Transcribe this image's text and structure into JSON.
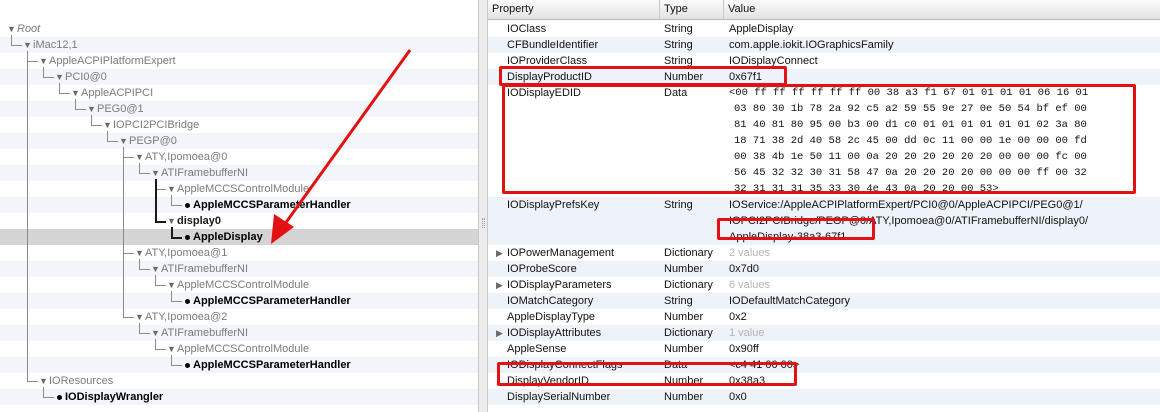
{
  "tree": {
    "nodes": [
      {
        "id": "root",
        "label": "Root",
        "level": 0,
        "triangle": "open",
        "style": "root"
      },
      {
        "id": "imac",
        "label": "iMac12,1",
        "level": 1,
        "triangle": "open",
        "style": "normal"
      },
      {
        "id": "acpi-platform",
        "label": "AppleACPIPlatformExpert",
        "level": 2,
        "triangle": "open",
        "style": "normal"
      },
      {
        "id": "pci0",
        "label": "PCI0@0",
        "level": 3,
        "triangle": "open",
        "style": "normal"
      },
      {
        "id": "acpi-pci",
        "label": "AppleACPIPCI",
        "level": 4,
        "triangle": "open",
        "style": "normal"
      },
      {
        "id": "peg0",
        "label": "PEG0@1",
        "level": 5,
        "triangle": "open",
        "style": "normal"
      },
      {
        "id": "pci2pci",
        "label": "IOPCI2PCIBridge",
        "level": 6,
        "triangle": "open",
        "style": "normal"
      },
      {
        "id": "pegp",
        "label": "PEGP@0",
        "level": 7,
        "triangle": "open",
        "style": "normal"
      },
      {
        "id": "aty0",
        "label": "ATY,Ipomoea@0",
        "level": 8,
        "triangle": "open",
        "style": "normal"
      },
      {
        "id": "fb0",
        "label": "ATIFramebufferNI",
        "level": 9,
        "triangle": "open",
        "style": "normal"
      },
      {
        "id": "mccs0",
        "label": "AppleMCCSControlModule",
        "level": 10,
        "triangle": "open",
        "style": "normal"
      },
      {
        "id": "handler0",
        "label": "AppleMCCSParameterHandler",
        "level": 11,
        "triangle": "none",
        "style": "leaf"
      },
      {
        "id": "display0",
        "label": "display0",
        "level": 10,
        "triangle": "open",
        "style": "dark"
      },
      {
        "id": "appledisplay",
        "label": "AppleDisplay",
        "level": 11,
        "triangle": "none",
        "style": "leaf",
        "selected": true
      },
      {
        "id": "aty1",
        "label": "ATY,Ipomoea@1",
        "level": 8,
        "triangle": "open",
        "style": "normal"
      },
      {
        "id": "fb1",
        "label": "ATIFramebufferNI",
        "level": 9,
        "triangle": "open",
        "style": "normal"
      },
      {
        "id": "mccs1",
        "label": "AppleMCCSControlModule",
        "level": 10,
        "triangle": "open",
        "style": "normal"
      },
      {
        "id": "handler1",
        "label": "AppleMCCSParameterHandler",
        "level": 11,
        "triangle": "none",
        "style": "leaf"
      },
      {
        "id": "aty2",
        "label": "ATY,Ipomoea@2",
        "level": 8,
        "triangle": "open",
        "style": "normal"
      },
      {
        "id": "fb2",
        "label": "ATIFramebufferNI",
        "level": 9,
        "triangle": "open",
        "style": "normal"
      },
      {
        "id": "mccs2",
        "label": "AppleMCCSControlModule",
        "level": 10,
        "triangle": "open",
        "style": "normal"
      },
      {
        "id": "handler2",
        "label": "AppleMCCSParameterHandler",
        "level": 11,
        "triangle": "none",
        "style": "leaf"
      },
      {
        "id": "ioresources",
        "label": "IOResources",
        "level": 2,
        "triangle": "open",
        "style": "normal"
      },
      {
        "id": "wrangler",
        "label": "IODisplayWrangler",
        "level": 3,
        "triangle": "none",
        "style": "leaf"
      }
    ]
  },
  "table": {
    "columns": [
      "Property",
      "Type",
      "Value"
    ],
    "rows": [
      {
        "property": "IOClass",
        "type": "String",
        "value": "AppleDisplay"
      },
      {
        "property": "CFBundleIdentifier",
        "type": "String",
        "value": "com.apple.iokit.IOGraphicsFamily"
      },
      {
        "property": "IOProviderClass",
        "type": "String",
        "value": "IODisplayConnect"
      },
      {
        "property": "DisplayProductID",
        "type": "Number",
        "value": "0x67f1"
      },
      {
        "property": "IODisplayEDID",
        "type": "Data",
        "value_lines": [
          "<00 ff ff ff ff ff ff 00 38 a3 f1 67 01 01 01 01 06 16 01",
          "03 80 30 1b 78 2a 92 c5 a2 59 55 9e 27 0e 50 54 bf ef 00",
          "81 40 81 80 95 00 b3 00 d1 c0 01 01 01 01 01 01 02 3a 80",
          "18 71 38 2d 40 58 2c 45 00 dd 0c 11 00 00 1e 00 00 00 fd",
          "00 38 4b 1e 50 11 00 0a 20 20 20 20 20 20 00 00 00 fc 00",
          "56 45 32 32 30 31 58 47 0a 20 20 20 20 00 00 00 ff 00 32",
          "32 31 31 31 35 33 30 4e 43 0a 20 20 00 53>"
        ]
      },
      {
        "property": "IODisplayPrefsKey",
        "type": "String",
        "value_lines": [
          "IOService:/AppleACPIPlatformExpert/PCI0@0/AppleACPIPCI/PEG0@1/",
          "IOPCI2PCIBridge/PEGP@0/ATY,Ipomoea@0/ATIFramebufferNI/display0/",
          "AppleDisplay-38a3-67f1"
        ]
      },
      {
        "property": "IOPowerManagement",
        "type": "Dictionary",
        "value": "2 values",
        "expandable": true,
        "grey": true
      },
      {
        "property": "IOProbeScore",
        "type": "Number",
        "value": "0x7d0"
      },
      {
        "property": "IODisplayParameters",
        "type": "Dictionary",
        "value": "6 values",
        "expandable": true,
        "grey": true
      },
      {
        "property": "IOMatchCategory",
        "type": "String",
        "value": "IODefaultMatchCategory"
      },
      {
        "property": "AppleDisplayType",
        "type": "Number",
        "value": "0x2"
      },
      {
        "property": "IODisplayAttributes",
        "type": "Dictionary",
        "value": "1 value",
        "expandable": true,
        "grey": true
      },
      {
        "property": "AppleSense",
        "type": "Number",
        "value": "0x90ff"
      },
      {
        "property": "IODisplayConnectFlags",
        "type": "Data",
        "value": "<c4 41 00 00>"
      },
      {
        "property": "DisplayVendorID",
        "type": "Number",
        "value": "0x38a3"
      },
      {
        "property": "DisplaySerialNumber",
        "type": "Number",
        "value": "0x0"
      }
    ]
  },
  "annotation_color": "#e31111",
  "icons": {
    "expanded": "triangle-down-icon",
    "collapsed": "triangle-right-icon",
    "leaf": "dot-icon"
  }
}
